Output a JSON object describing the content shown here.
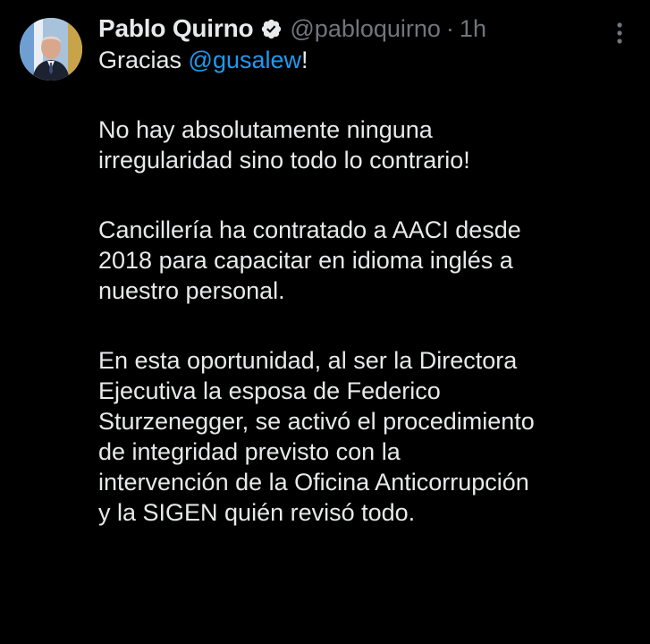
{
  "tweet": {
    "author": {
      "display_name": "Pablo Quirno",
      "verified_icon": "verified-badge-icon",
      "handle": "@pabloquirno",
      "separator": "·",
      "time": "1h"
    },
    "more_icon": "more-options-icon",
    "body": {
      "p1": {
        "prefix": "Gracias ",
        "mention": "@gusalew",
        "suffix": "!"
      },
      "p2": [
        "No hay absolutamente ninguna",
        "irregularidad sino todo lo contrario!"
      ],
      "p3": [
        "Cancillería ha contratado a AACI desde",
        "2018 para capacitar en idioma inglés a",
        "nuestro personal."
      ],
      "p4": [
        "En esta oportunidad, al ser la Directora",
        "Ejecutiva la esposa de Federico",
        "Sturzenegger, se activó el procedimiento",
        "de integridad previsto con la",
        "intervención de la Oficina Anticorrupción",
        "y la SIGEN quién revisó todo."
      ]
    },
    "colors": {
      "background": "#000000",
      "text": "#e7e9ea",
      "secondary": "#71767b",
      "link": "#1d9bf0"
    }
  }
}
